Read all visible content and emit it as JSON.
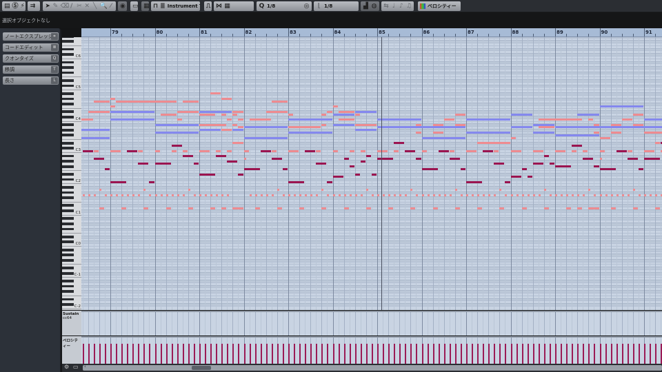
{
  "toolbar": {
    "track_type": "Instrument Tr",
    "quantize": "1/8",
    "length": "1/8",
    "controller": "ベロシティー"
  },
  "status": "選択オブジェクトなし",
  "inspector": {
    "items": [
      {
        "label": "ノートエクスプレッション",
        "key": "⌗"
      },
      {
        "label": "コードエディット",
        "key": "≣"
      },
      {
        "label": "クオンタイズ",
        "key": "Q"
      },
      {
        "label": "移調",
        "key": "T"
      },
      {
        "label": "長さ",
        "key": "L"
      }
    ]
  },
  "ruler": {
    "bars": [
      79,
      80,
      81,
      82,
      83,
      84,
      85,
      86,
      87,
      88,
      89,
      90,
      91
    ]
  },
  "keyboard": {
    "labels": [
      {
        "label": "C6",
        "pitch": 96
      },
      {
        "label": "C5",
        "pitch": 84
      },
      {
        "label": "C4",
        "pitch": 72
      },
      {
        "label": "C3",
        "pitch": 60
      },
      {
        "label": "C2",
        "pitch": 48
      },
      {
        "label": "C1",
        "pitch": 36
      },
      {
        "label": "C0",
        "pitch": 24
      },
      {
        "label": "C-1",
        "pitch": 12
      },
      {
        "label": "C-2",
        "pitch": 0
      }
    ]
  },
  "lanes": {
    "sustain": "Sustain",
    "sustain_cc": "cc64",
    "velocity": "ベロシティー"
  },
  "colors": {
    "b": "#8488ee",
    "p": "#ee8b90",
    "m": "#9b1450"
  },
  "playhead_beat": 28.35,
  "notes": [
    [
      4,
      0.5,
      80,
      "p"
    ],
    [
      2.5,
      1.5,
      79,
      "p"
    ],
    [
      4.5,
      5.5,
      79,
      "p"
    ],
    [
      10.5,
      1.5,
      79,
      "p"
    ],
    [
      4,
      0.5,
      77,
      "p"
    ],
    [
      2,
      2,
      75,
      "p"
    ],
    [
      4,
      4,
      75,
      "b"
    ],
    [
      10,
      2,
      75,
      "p"
    ],
    [
      8.5,
      1.5,
      74,
      "p"
    ],
    [
      1,
      1.5,
      72,
      "p"
    ],
    [
      4,
      4,
      72,
      "b"
    ],
    [
      10,
      0.5,
      72,
      "p"
    ],
    [
      8,
      4,
      70,
      "b"
    ],
    [
      1,
      3,
      68,
      "b"
    ],
    [
      8,
      4,
      67,
      "b"
    ],
    [
      1,
      3,
      65,
      "b"
    ],
    [
      9.5,
      1,
      62,
      "m"
    ],
    [
      1.5,
      1,
      60,
      "m"
    ],
    [
      2.5,
      0.5,
      60,
      "p"
    ],
    [
      4,
      1,
      60,
      "p"
    ],
    [
      5.5,
      1,
      60,
      "m"
    ],
    [
      6.5,
      0.5,
      60,
      "p"
    ],
    [
      8,
      0.5,
      60,
      "p"
    ],
    [
      9.5,
      0.5,
      60,
      "p"
    ],
    [
      10.5,
      0.5,
      60,
      "p"
    ],
    [
      10.5,
      1,
      58,
      "m"
    ],
    [
      2.5,
      1,
      57,
      "m"
    ],
    [
      6.5,
      1,
      55,
      "m"
    ],
    [
      8,
      1.5,
      55,
      "m"
    ],
    [
      11.5,
      0.5,
      55,
      "m"
    ],
    [
      3.5,
      0.5,
      53,
      "m"
    ],
    [
      4,
      1.5,
      48,
      "m"
    ],
    [
      7.5,
      0.5,
      48,
      "m"
    ],
    [
      13,
      1,
      82,
      "p"
    ],
    [
      14,
      1,
      80,
      "p"
    ],
    [
      18.5,
      1.5,
      79,
      "p"
    ],
    [
      12,
      3,
      75,
      "b"
    ],
    [
      15,
      1,
      75,
      "p"
    ],
    [
      18,
      2,
      75,
      "p"
    ],
    [
      23.5,
      0.5,
      75,
      "p"
    ],
    [
      12,
      1.5,
      74,
      "p"
    ],
    [
      14,
      0.5,
      74,
      "p"
    ],
    [
      15,
      0.5,
      74,
      "p"
    ],
    [
      20,
      0.5,
      74,
      "p"
    ],
    [
      23,
      0.5,
      74,
      "p"
    ],
    [
      14.5,
      0.5,
      72,
      "p"
    ],
    [
      15.5,
      0.5,
      72,
      "p"
    ],
    [
      16.5,
      2,
      72,
      "p"
    ],
    [
      20,
      4,
      72,
      "b"
    ],
    [
      12,
      2.5,
      70,
      "p"
    ],
    [
      15,
      0.5,
      70,
      "p"
    ],
    [
      23,
      0.5,
      70,
      "p"
    ],
    [
      15.5,
      0.5,
      69,
      "p"
    ],
    [
      16,
      4,
      69,
      "b"
    ],
    [
      20,
      3,
      69,
      "p"
    ],
    [
      12,
      2,
      68,
      "b"
    ],
    [
      14,
      1,
      68,
      "p"
    ],
    [
      15,
      1,
      68,
      "b"
    ],
    [
      20,
      4,
      67,
      "b"
    ],
    [
      16,
      4,
      65,
      "b"
    ],
    [
      15,
      1,
      63,
      "p"
    ],
    [
      12,
      1,
      60,
      "p"
    ],
    [
      13.5,
      0.5,
      60,
      "p"
    ],
    [
      14.5,
      0.5,
      60,
      "p"
    ],
    [
      16,
      0.5,
      60,
      "p"
    ],
    [
      17.5,
      1,
      60,
      "m"
    ],
    [
      18.5,
      0.5,
      60,
      "p"
    ],
    [
      20,
      1,
      60,
      "p"
    ],
    [
      21.5,
      1,
      60,
      "m"
    ],
    [
      22.5,
      0.5,
      60,
      "p"
    ],
    [
      13.5,
      1,
      58,
      "m"
    ],
    [
      16,
      0.25,
      57,
      "p"
    ],
    [
      18.5,
      1,
      57,
      "m"
    ],
    [
      14.5,
      1,
      56,
      "m"
    ],
    [
      22.5,
      1,
      55,
      "m"
    ],
    [
      16,
      1.5,
      53,
      "m"
    ],
    [
      19.5,
      0.5,
      53,
      "m"
    ],
    [
      12,
      1.5,
      51,
      "m"
    ],
    [
      15.5,
      0.5,
      51,
      "m"
    ],
    [
      20,
      1.5,
      48,
      "m"
    ],
    [
      23.5,
      0.5,
      48,
      "m"
    ],
    [
      24,
      0.5,
      77,
      "p"
    ],
    [
      24.5,
      1.5,
      75,
      "p"
    ],
    [
      26,
      2,
      75,
      "b"
    ],
    [
      24,
      2,
      74,
      "b"
    ],
    [
      26,
      0.5,
      74,
      "p"
    ],
    [
      35,
      1,
      74,
      "p"
    ],
    [
      24.5,
      1.5,
      72,
      "p"
    ],
    [
      28,
      4,
      72,
      "b"
    ],
    [
      34,
      1,
      72,
      "p"
    ],
    [
      24,
      2,
      70,
      "b"
    ],
    [
      26,
      2,
      70,
      "p"
    ],
    [
      31.5,
      0.5,
      70,
      "p"
    ],
    [
      33,
      1,
      70,
      "p"
    ],
    [
      35,
      1,
      70,
      "p"
    ],
    [
      28,
      8,
      69,
      "b"
    ],
    [
      26,
      2,
      68,
      "b"
    ],
    [
      31.5,
      0.5,
      67,
      "p"
    ],
    [
      33,
      1,
      67,
      "p"
    ],
    [
      32,
      4,
      65,
      "b"
    ],
    [
      29.5,
      1,
      63,
      "m"
    ],
    [
      24,
      0.5,
      60,
      "p"
    ],
    [
      25.5,
      0.5,
      60,
      "p"
    ],
    [
      26.5,
      0.5,
      60,
      "p"
    ],
    [
      28,
      1,
      60,
      "p"
    ],
    [
      29.5,
      0.5,
      60,
      "p"
    ],
    [
      30.5,
      1,
      60,
      "m"
    ],
    [
      32,
      0.5,
      60,
      "p"
    ],
    [
      33.5,
      1,
      60,
      "m"
    ],
    [
      34.5,
      0.5,
      60,
      "p"
    ],
    [
      27,
      0.5,
      58,
      "m"
    ],
    [
      25,
      0.5,
      57,
      "m"
    ],
    [
      28,
      1.5,
      57,
      "m"
    ],
    [
      31.5,
      0.5,
      57,
      "m"
    ],
    [
      34.5,
      1,
      57,
      "m"
    ],
    [
      26.5,
      0.5,
      56,
      "m"
    ],
    [
      25.5,
      0.5,
      54,
      "m"
    ],
    [
      32,
      1.5,
      53,
      "m"
    ],
    [
      35.5,
      0.5,
      53,
      "m"
    ],
    [
      26,
      0.5,
      51,
      "m"
    ],
    [
      27.5,
      0.5,
      51,
      "m"
    ],
    [
      24,
      1,
      50,
      "m"
    ],
    [
      48,
      4,
      77,
      "b"
    ],
    [
      40,
      2,
      74,
      "b"
    ],
    [
      46,
      2,
      74,
      "b"
    ],
    [
      36,
      4,
      72,
      "b"
    ],
    [
      42.5,
      4,
      72,
      "p"
    ],
    [
      47,
      0.5,
      72,
      "p"
    ],
    [
      42,
      2,
      70,
      "b"
    ],
    [
      47.5,
      0.5,
      70,
      "p"
    ],
    [
      40,
      2,
      69,
      "b"
    ],
    [
      42.5,
      1.5,
      69,
      "p"
    ],
    [
      44,
      10,
      69,
      "b"
    ],
    [
      36,
      4,
      67,
      "b"
    ],
    [
      42,
      2,
      67,
      "b"
    ],
    [
      47.5,
      0.5,
      67,
      "p"
    ],
    [
      44,
      4,
      66,
      "b"
    ],
    [
      40,
      0.5,
      65,
      "p"
    ],
    [
      48,
      1,
      65,
      "p"
    ],
    [
      37,
      3,
      63,
      "p"
    ],
    [
      45.5,
      1,
      62,
      "m"
    ],
    [
      36,
      1,
      60,
      "p"
    ],
    [
      37.5,
      1,
      60,
      "m"
    ],
    [
      38.5,
      0.5,
      60,
      "p"
    ],
    [
      40,
      1,
      60,
      "p"
    ],
    [
      42,
      1,
      60,
      "p"
    ],
    [
      44,
      1,
      60,
      "p"
    ],
    [
      45.5,
      0.5,
      60,
      "p"
    ],
    [
      46.5,
      0.5,
      60,
      "p"
    ],
    [
      43,
      0.5,
      58,
      "m"
    ],
    [
      46.5,
      1,
      57,
      "m"
    ],
    [
      48,
      0.25,
      57,
      "p"
    ],
    [
      38.5,
      1,
      55,
      "m"
    ],
    [
      42,
      1,
      55,
      "m"
    ],
    [
      43.5,
      0.5,
      55,
      "m"
    ],
    [
      44,
      1.5,
      54,
      "m"
    ],
    [
      47.5,
      0.5,
      54,
      "m"
    ],
    [
      41,
      0.5,
      53,
      "m"
    ],
    [
      40,
      1,
      50,
      "m"
    ],
    [
      41.5,
      0.5,
      50,
      "m"
    ],
    [
      36,
      1.5,
      48,
      "m"
    ],
    [
      39.5,
      0.5,
      48,
      "m"
    ],
    [
      51,
      1,
      74,
      "p"
    ],
    [
      50,
      1,
      72,
      "p"
    ],
    [
      52,
      2,
      72,
      "b"
    ],
    [
      49,
      1,
      70,
      "p"
    ],
    [
      51,
      1,
      70,
      "p"
    ],
    [
      49,
      1,
      67,
      "p"
    ],
    [
      52,
      2,
      67,
      "p"
    ],
    [
      53,
      0.5,
      63,
      "p"
    ],
    [
      53.5,
      0.5,
      63,
      "m"
    ],
    [
      48,
      0.5,
      60,
      "p"
    ],
    [
      49.5,
      1,
      60,
      "m"
    ],
    [
      50.5,
      0.5,
      60,
      "p"
    ],
    [
      52,
      1,
      60,
      "p"
    ],
    [
      53.5,
      0.5,
      60,
      "p"
    ],
    [
      50.5,
      1,
      57,
      "m"
    ],
    [
      52,
      1.5,
      57,
      "m"
    ],
    [
      48,
      1.5,
      53,
      "m"
    ],
    [
      51.5,
      0.5,
      53,
      "m"
    ]
  ],
  "bass_d1": {
    "pitch": 38,
    "color": "p",
    "beats": [
      3,
      5,
      7,
      9,
      11,
      13,
      14,
      15,
      17,
      19,
      21,
      23,
      25,
      27,
      29,
      31,
      33,
      35,
      37,
      39,
      41,
      43,
      45,
      46,
      47,
      49,
      51,
      53
    ]
  },
  "bass_a1": {
    "pitch": 45,
    "color": "p",
    "beats": [
      3,
      7,
      11,
      19,
      23,
      27,
      31,
      35,
      39,
      43,
      47,
      51
    ]
  },
  "pulse": {
    "pitch": 43,
    "color": "p",
    "start": 1.5,
    "end": 54,
    "step": 0.5,
    "extra_rests": [
      15.5,
      16
    ]
  }
}
